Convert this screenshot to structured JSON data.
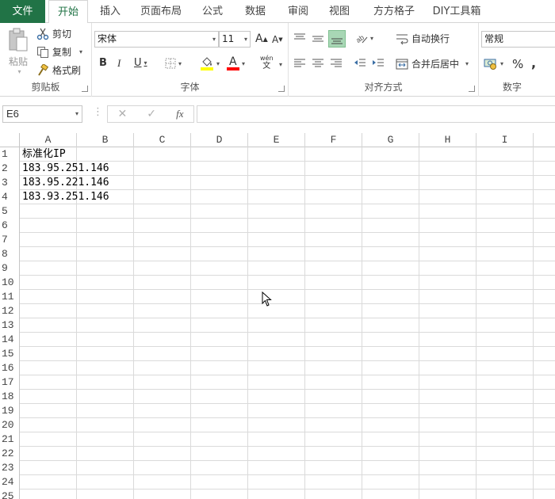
{
  "tabs": [
    {
      "label": "文件"
    },
    {
      "label": "开始"
    },
    {
      "label": "插入"
    },
    {
      "label": "页面布局"
    },
    {
      "label": "公式"
    },
    {
      "label": "数据"
    },
    {
      "label": "审阅"
    },
    {
      "label": "视图"
    },
    {
      "label": "方方格子"
    },
    {
      "label": "DIY工具箱"
    }
  ],
  "ribbon": {
    "clipboard": {
      "group_label": "剪贴板",
      "paste_label": "粘贴",
      "cut_label": "剪切",
      "copy_label": "复制",
      "format_painter_label": "格式刷"
    },
    "font": {
      "group_label": "字体",
      "font_name": "宋体",
      "font_size": "11",
      "bold": "B",
      "italic": "I",
      "underline": "U",
      "phonetic_top": "wén",
      "phonetic_bottom": "文",
      "grow": "A",
      "shrink": "A",
      "font_color_glyph": "A"
    },
    "alignment": {
      "group_label": "对齐方式",
      "wrap_text_label": "自动换行",
      "merge_center_label": "合并后居中"
    },
    "number": {
      "group_label": "数字",
      "format": "常规",
      "percent": "%",
      "comma": ","
    }
  },
  "formula_bar": {
    "name_box": "E6",
    "cancel": "✕",
    "enter": "✓",
    "fx": "fx",
    "formula": ""
  },
  "grid": {
    "columns": [
      "A",
      "B",
      "C",
      "D",
      "E",
      "F",
      "G",
      "H",
      "I"
    ],
    "rows": [
      "1",
      "2",
      "3",
      "4",
      "5",
      "6",
      "7",
      "8",
      "9",
      "10",
      "11",
      "12",
      "13",
      "14",
      "15",
      "16",
      "17",
      "18",
      "19",
      "20",
      "21",
      "22",
      "23",
      "24",
      "25"
    ],
    "cells": [
      {
        "ref": "A1",
        "value": "标准化IP"
      },
      {
        "ref": "A2",
        "value": "183.95.251.146"
      },
      {
        "ref": "A3",
        "value": "183.95.221.146"
      },
      {
        "ref": "A4",
        "value": "183.93.251.146"
      }
    ]
  },
  "colors": {
    "accent": "#217346",
    "highlight_fill": "#ffff00",
    "font_color_bar": "#ff0000",
    "active_align_bg": "#a8d7b5"
  }
}
